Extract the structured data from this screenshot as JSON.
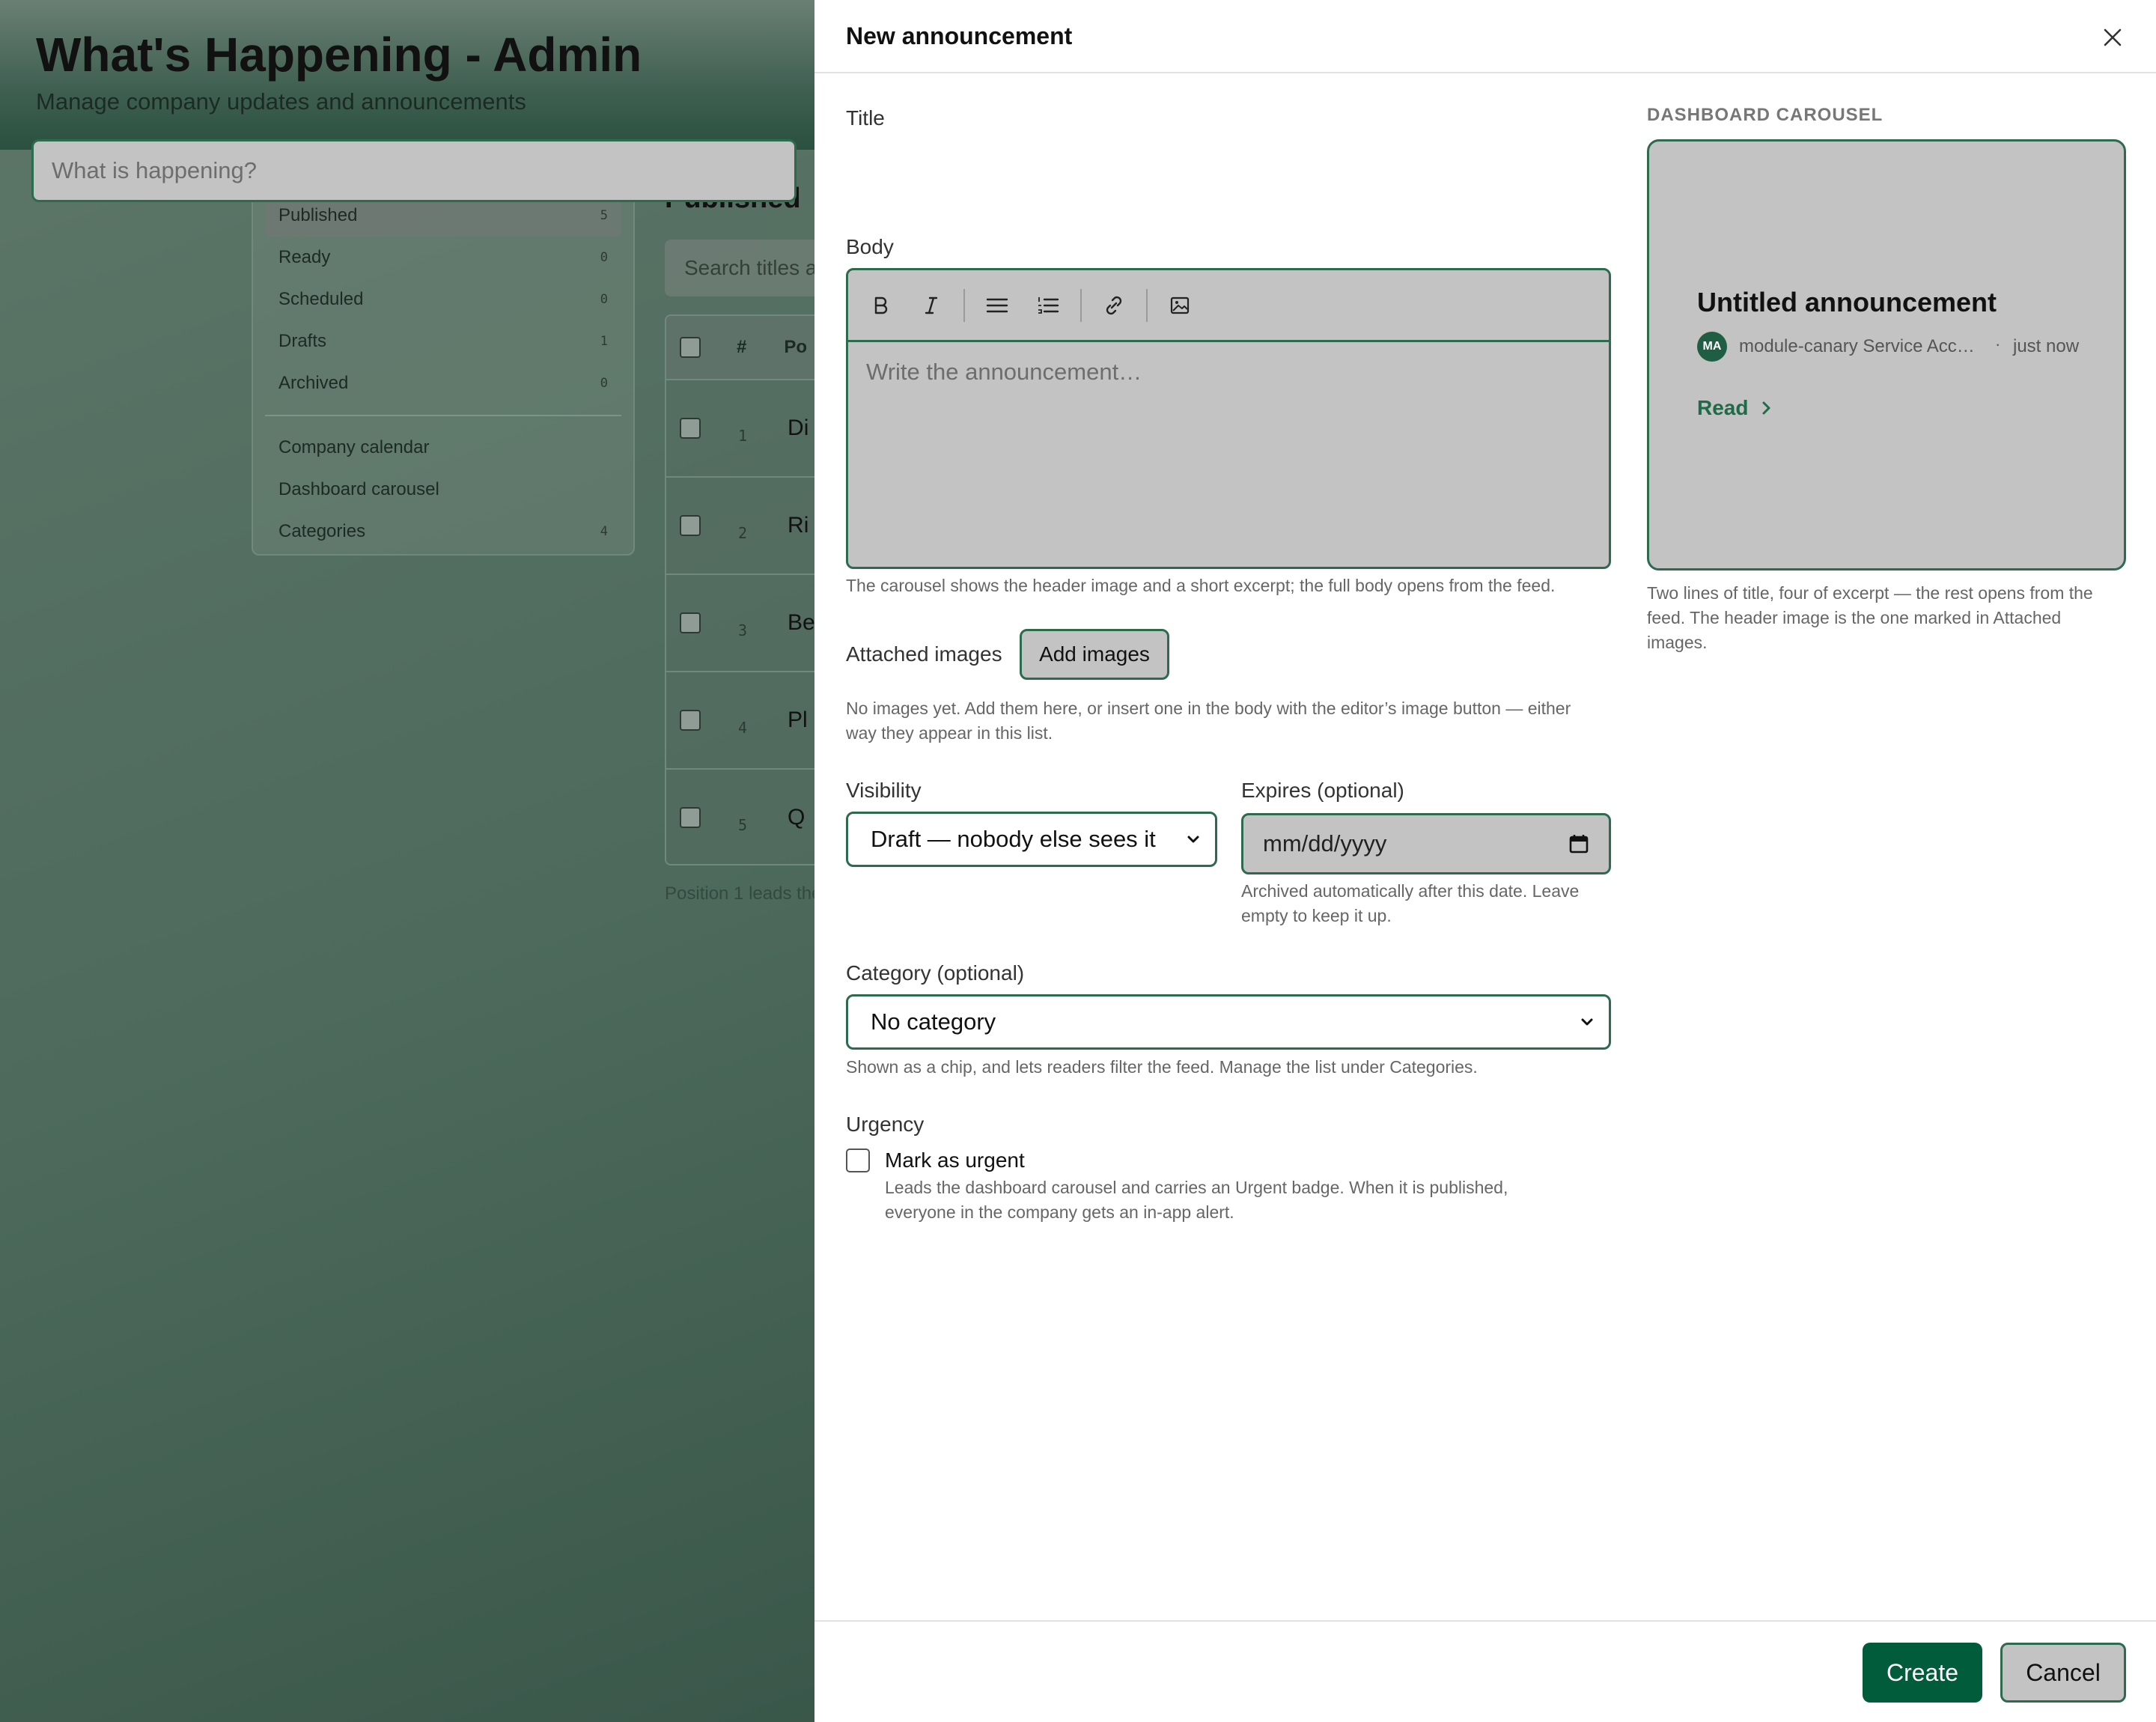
{
  "app": {
    "title": "What's Happening - Admin",
    "subtitle": "Manage company updates and announcements"
  },
  "sidebar": {
    "items": [
      {
        "label": "Published",
        "count": "5"
      },
      {
        "label": "Ready",
        "count": "0"
      },
      {
        "label": "Scheduled",
        "count": "0"
      },
      {
        "label": "Drafts",
        "count": "1"
      },
      {
        "label": "Archived",
        "count": "0"
      }
    ],
    "links": [
      {
        "label": "Company calendar"
      },
      {
        "label": "Dashboard carousel"
      },
      {
        "label": "Categories",
        "count": "4"
      }
    ]
  },
  "list": {
    "title": "Published",
    "search_placeholder": "Search titles a",
    "col_num": "#",
    "col_pos": "Po",
    "rows": [
      {
        "num": "1",
        "name": "Di"
      },
      {
        "num": "2",
        "name": "Ri"
      },
      {
        "num": "3",
        "name": "Be"
      },
      {
        "num": "4",
        "name": "Pl"
      },
      {
        "num": "5",
        "name": "Q"
      }
    ],
    "footer": "Position 1 leads the"
  },
  "modal": {
    "title": "New announcement",
    "title_label": "Title",
    "title_placeholder": "What is happening?",
    "body_label": "Body",
    "body_placeholder": "Write the announcement…",
    "body_help": "The carousel shows the header image and a short excerpt; the full body opens from the feed.",
    "attached_label": "Attached images",
    "add_images_label": "Add images",
    "images_help_1": "No images yet. Add them here, or insert one in the body with the editor’s image button — either",
    "images_help_2": "way they appear in this list.",
    "visibility_label": "Visibility",
    "visibility_value": "Draft — nobody else sees it",
    "expires_label": "Expires (optional)",
    "expires_placeholder": "mm/dd/yyyy",
    "expires_help_1": "Archived automatically after this date. Leave",
    "expires_help_2": "empty to keep it up.",
    "category_label": "Category (optional)",
    "category_value": "No category",
    "category_help": "Shown as a chip, and lets readers filter the feed. Manage the list under Categories.",
    "urgency_label": "Urgency",
    "urgent_checkbox_label": "Mark as urgent",
    "urgent_help_1": "Leads the dashboard carousel and carries an Urgent badge. When it is published,",
    "urgent_help_2": "everyone in the company gets an in-app alert.",
    "create_label": "Create",
    "cancel_label": "Cancel"
  },
  "preview": {
    "section_label": "DASHBOARD CAROUSEL",
    "title": "Untitled announcement",
    "avatar_initials": "MA",
    "author": "module-canary Service Acc…",
    "dot": "·",
    "time": "just now",
    "read_label": "Read",
    "help_1": "Two lines of title, four of excerpt — the rest opens from the",
    "help_2": "feed. The header image is the one marked in Attached",
    "help_3": "images."
  },
  "colors": {
    "brand": "#005c3b",
    "border": "#2e6a4e",
    "field_bg": "#c3c3c3"
  }
}
